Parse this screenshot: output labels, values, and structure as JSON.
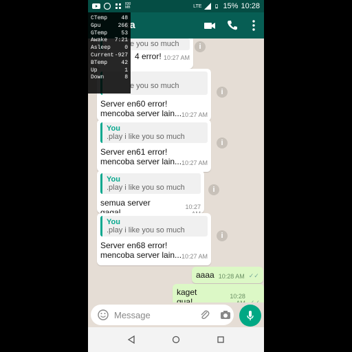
{
  "statusbar": {
    "network": "LTE",
    "battery": "15%",
    "time": "10:28",
    "speed_top": "830",
    "speed_bottom": "MB"
  },
  "appbar": {
    "title_fragment": "ca"
  },
  "overlay": [
    {
      "k": "CTemp",
      "v": "48"
    },
    {
      "k": "Gpu",
      "v": "266"
    },
    {
      "k": "GTemp",
      "v": "53"
    },
    {
      "k": "Awake",
      "v": "7:21"
    },
    {
      "k": "Asleep",
      "v": "0"
    },
    {
      "k": "Current",
      "v": "-927"
    },
    {
      "k": "BTemp",
      "v": "42"
    },
    {
      "k": "Up",
      "v": "1"
    },
    {
      "k": "Down",
      "v": "8"
    }
  ],
  "chat": {
    "partial1": {
      "quote": "e you so much",
      "text": "4 error!",
      "time": "10:27 AM"
    },
    "partial2": {
      "quote": "e you so much",
      "text1": "Server en60 error!",
      "text2": "mencoba server lain...",
      "time": "10:27 AM"
    },
    "msg3": {
      "who": "You",
      "quote": ".play i like you so much",
      "text1": "Server en61 error!",
      "text2": "mencoba server lain...",
      "time": "10:27 AM"
    },
    "msg4": {
      "who": "You",
      "quote": ".play i like you so much",
      "text1": "semua server gagal",
      "time": "10:27 AM"
    },
    "msg5": {
      "who": "You",
      "quote": ".play i like you so much",
      "text1": "Server en68 error!",
      "text2": "mencoba server lain...",
      "time": "10:27 AM"
    },
    "out1": {
      "text": "aaaa",
      "time": "10:28 AM"
    },
    "out2": {
      "text": "kaget gua!",
      "time": "10:28 AM"
    }
  },
  "input": {
    "placeholder": "Message"
  }
}
